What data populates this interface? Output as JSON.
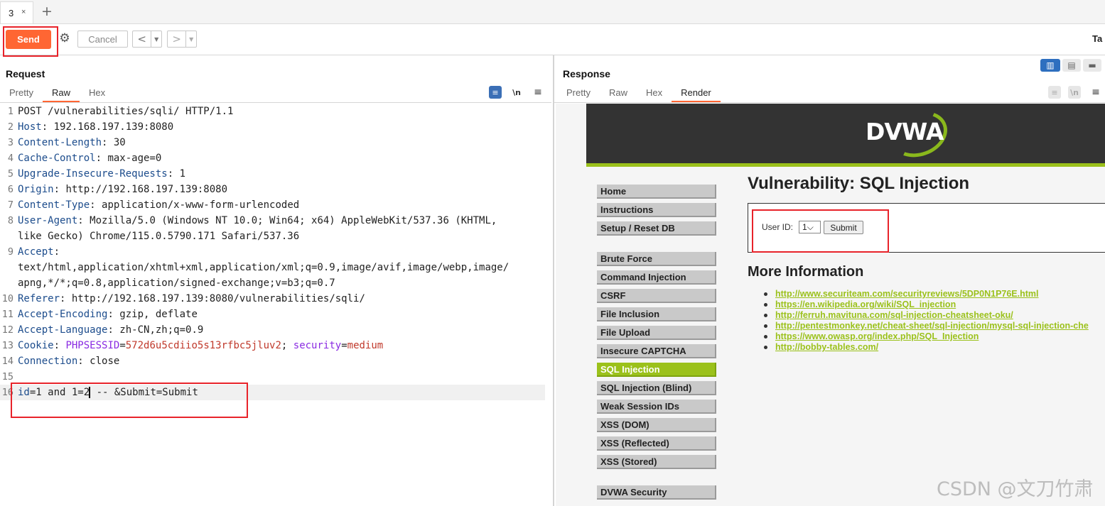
{
  "tabs": {
    "items": [
      {
        "label": "3",
        "close": "×"
      }
    ],
    "add": "+"
  },
  "toolbar": {
    "send": "Send",
    "settings_icon": "gear-icon",
    "cancel": "Cancel",
    "back": "<",
    "forward": ">",
    "dropdown": "▼",
    "target": "Ta"
  },
  "request": {
    "title": "Request",
    "tabs": [
      "Pretty",
      "Raw",
      "Hex"
    ],
    "active_tab": "Raw",
    "icons": {
      "wrap": "≡",
      "newline": "\\n",
      "menu": "≡"
    },
    "line_numbers": [
      "1",
      "2",
      "3",
      "4",
      "5",
      "6",
      "7",
      "8",
      "",
      "9",
      "",
      "",
      "10",
      "11",
      "12",
      "13",
      "14",
      "15",
      "16"
    ],
    "start_line": "POST /vulnerabilities/sqli/ HTTP/1.1",
    "headers": [
      {
        "k": "Host",
        "v": " 192.168.197.139:8080"
      },
      {
        "k": "Content-Length",
        "v": " 30"
      },
      {
        "k": "Cache-Control",
        "v": " max-age=0"
      },
      {
        "k": "Upgrade-Insecure-Requests",
        "v": " 1"
      },
      {
        "k": "Origin",
        "v": " http://192.168.197.139:8080"
      },
      {
        "k": "Content-Type",
        "v": " application/x-www-form-urlencoded"
      },
      {
        "k": "User-Agent",
        "v": " Mozilla/5.0 (Windows NT 10.0; Win64; x64) AppleWebKit/537.36 (KHTML,"
      },
      {
        "k": "Accept",
        "v": ""
      },
      {
        "k": "Referer",
        "v": " http://192.168.197.139:8080/vulnerabilities/sqli/"
      },
      {
        "k": "Accept-Encoding",
        "v": " gzip, deflate"
      },
      {
        "k": "Accept-Language",
        "v": " zh-CN,zh;q=0.9"
      },
      {
        "k": "Cookie",
        "v": " "
      },
      {
        "k": "Connection",
        "v": " close"
      }
    ],
    "ua_cont": "like Gecko) Chrome/115.0.5790.171 Safari/537.36",
    "accept_1": "text/html,application/xhtml+xml,application/xml;q=0.9,image/avif,image/webp,image/",
    "accept_2": "apng,*/*;q=0.8,application/signed-exchange;v=b3;q=0.7",
    "cookie": {
      "k1": "PHPSESSID",
      "v1": "572d6u5cdiio5s13rfbc5jluv2",
      "sep": "; ",
      "k2": "security",
      "v2": "medium",
      "eq": "="
    },
    "body": {
      "k": "id",
      "v_before_caret": "1 and 1=2",
      "v_after_caret": " -- &Submit=Submit"
    }
  },
  "response": {
    "title": "Response",
    "tabs": [
      "Pretty",
      "Raw",
      "Hex",
      "Render"
    ],
    "active_tab": "Render",
    "render": {
      "logo": "DVWA",
      "menu": [
        "Home",
        "Instructions",
        "Setup / Reset DB",
        "Brute Force",
        "Command Injection",
        "CSRF",
        "File Inclusion",
        "File Upload",
        "Insecure CAPTCHA",
        "SQL Injection",
        "SQL Injection (Blind)",
        "Weak Session IDs",
        "XSS (DOM)",
        "XSS (Reflected)",
        "XSS (Stored)",
        "DVWA Security"
      ],
      "selected_menu": "SQL Injection",
      "heading": "Vulnerability: SQL Injection",
      "user_id_label": "User ID:",
      "user_id_value": "1",
      "submit": "Submit",
      "more_info": "More Information",
      "links": [
        "http://www.securiteam.com/securityreviews/5DP0N1P76E.html",
        "https://en.wikipedia.org/wiki/SQL_injection",
        "http://ferruh.mavituna.com/sql-injection-cheatsheet-oku/",
        "http://pentestmonkey.net/cheat-sheet/sql-injection/mysql-sql-injection-che",
        "https://www.owasp.org/index.php/SQL_Injection",
        "http://bobby-tables.com/"
      ]
    }
  },
  "watermark": "CSDN @文刀竹肃",
  "colors": {
    "accent": "#ff6633",
    "highlight": "#e8232a",
    "dvwa_green": "#9bc11b"
  }
}
